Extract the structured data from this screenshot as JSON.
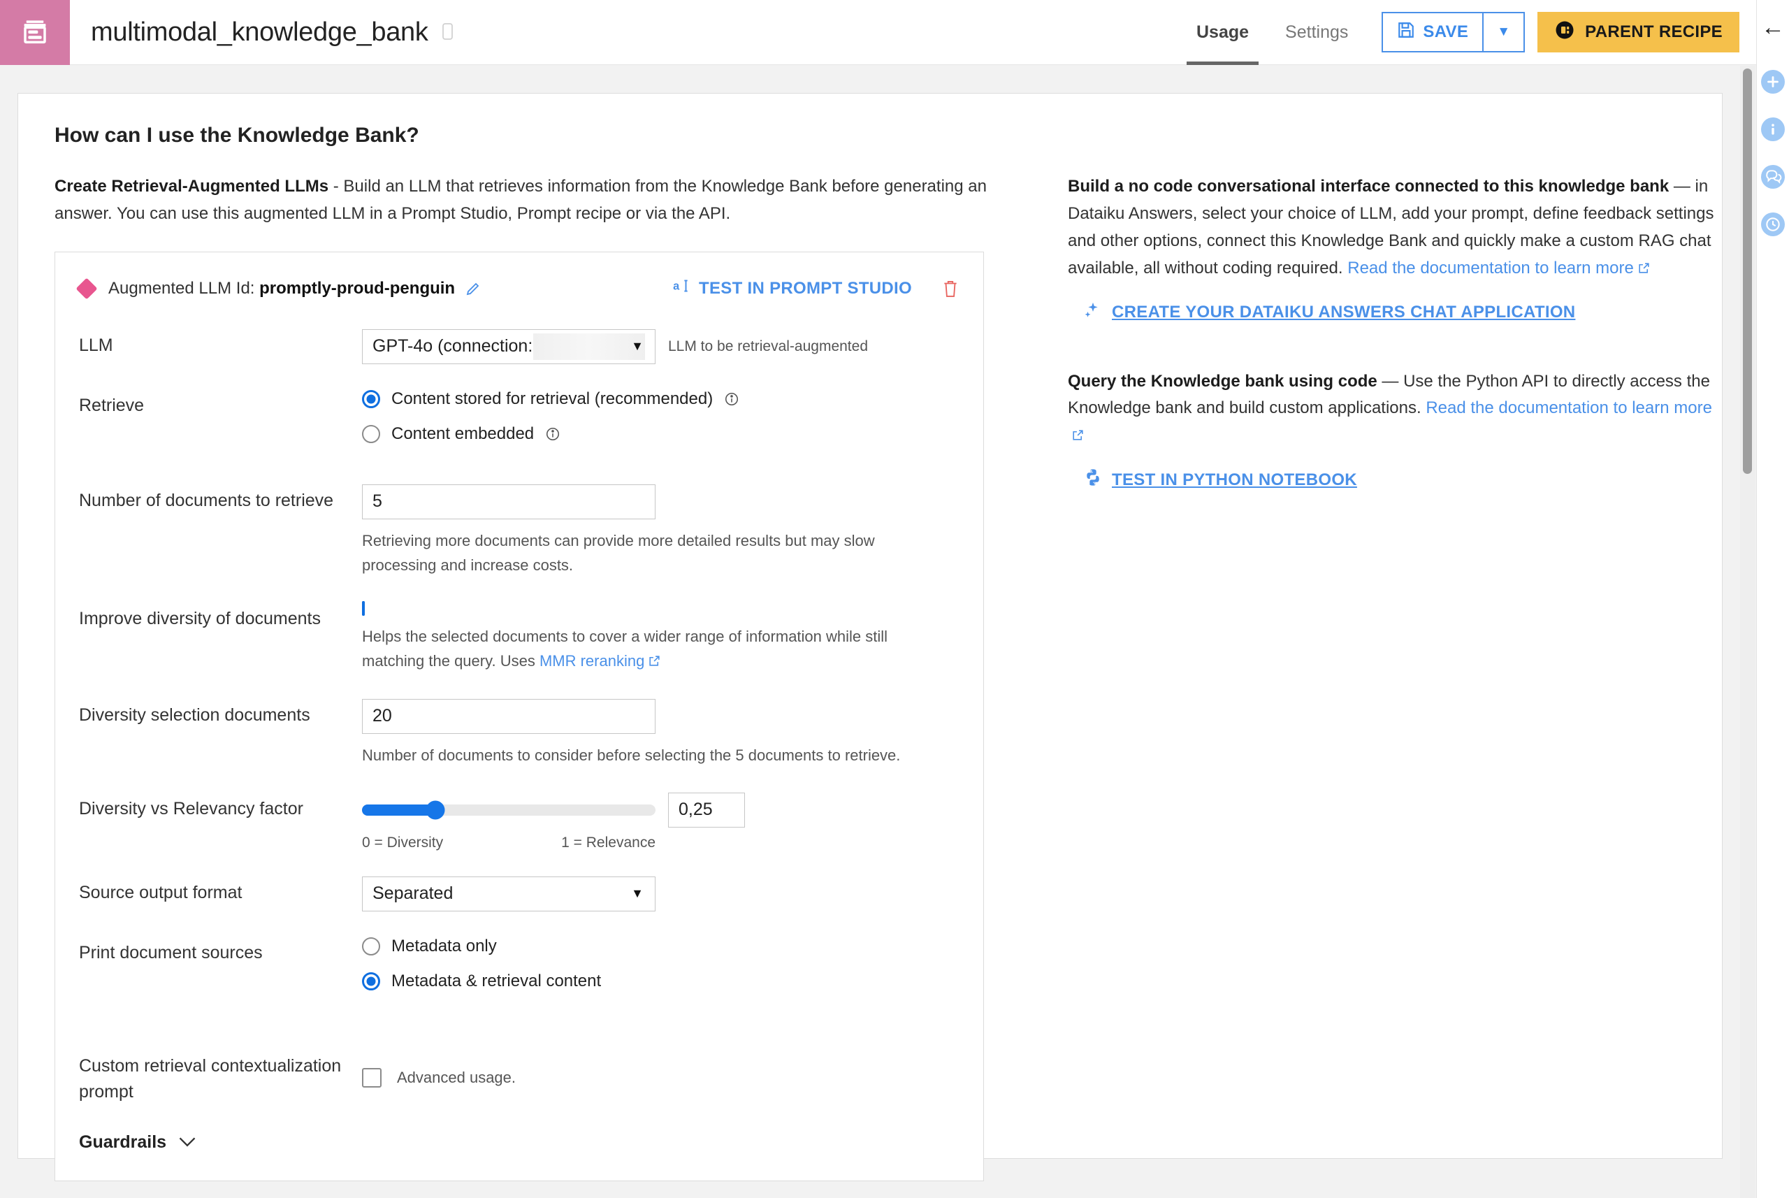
{
  "header": {
    "logo_icon": "knowledge-bank-icon",
    "logo_color": "#d47ba6",
    "title": "multimodal_knowledge_bank",
    "copy_icon": "copy-icon",
    "tabs": [
      {
        "label": "Usage",
        "active": true
      },
      {
        "label": "Settings",
        "active": false
      }
    ],
    "save_label": "SAVE",
    "save_icon": "floppy-disk-icon",
    "save_caret_icon": "chevron-down-icon",
    "parent_recipe_label": "PARENT RECIPE",
    "parent_recipe_icon": "recipe-icon",
    "parent_recipe_color": "#f5c04b",
    "accent_blue": "#4a90e8"
  },
  "rail": {
    "back_icon": "arrow-left-icon",
    "items": [
      {
        "icon": "plus-icon"
      },
      {
        "icon": "info-icon"
      },
      {
        "icon": "discussions-icon"
      },
      {
        "icon": "history-clock-icon"
      }
    ],
    "icon_color": "#9ec8f5"
  },
  "main": {
    "section_title": "How can I use the Knowledge Bank?",
    "left": {
      "intro_bold": "Create Retrieval-Augmented LLMs",
      "intro_rest": " - Build an LLM that retrieves information from the Knowledge Bank before generating an answer. You can use this augmented LLM in a Prompt Studio, Prompt recipe or via the API.",
      "card": {
        "id_prefix": "Augmented LLM Id:",
        "id_value": "promptly-proud-penguin",
        "edit_icon": "pencil-icon",
        "test_prompt_label": "TEST IN PROMPT STUDIO",
        "test_prompt_icon": "prompt-studio-icon",
        "delete_icon": "trash-icon",
        "fields": {
          "llm_label": "LLM",
          "llm_value": "GPT-4o (connection:",
          "llm_hint": "LLM to be retrieval-augmented",
          "retrieve_label": "Retrieve",
          "retrieve_options": [
            {
              "label": "Content stored for retrieval (recommended)",
              "selected": true,
              "info": true
            },
            {
              "label": "Content embedded",
              "selected": false,
              "info": true
            }
          ],
          "num_docs_label": "Number of documents to retrieve",
          "num_docs_value": "5",
          "num_docs_help": "Retrieving more documents can provide more detailed results but may slow processing and increase costs.",
          "diversity_label": "Improve diversity of documents",
          "diversity_checked": true,
          "diversity_help_pre": "Helps the selected documents to cover a wider range of information while still matching the query. Uses ",
          "diversity_help_link": "MMR reranking",
          "div_sel_label": "Diversity selection documents",
          "div_sel_value": "20",
          "div_sel_help": "Number of documents to consider before selecting the 5 documents to retrieve.",
          "factor_label": "Diversity vs Relevancy factor",
          "factor_value": "0,25",
          "factor_fraction": 0.25,
          "factor_min_label": "0 = Diversity",
          "factor_max_label": "1 = Relevance",
          "source_format_label": "Source output format",
          "source_format_value": "Separated",
          "print_sources_label": "Print document sources",
          "print_sources_options": [
            {
              "label": "Metadata only",
              "selected": false
            },
            {
              "label": "Metadata & retrieval content",
              "selected": true
            }
          ],
          "custom_prompt_label": "Custom retrieval contextualization prompt",
          "custom_prompt_checked": false,
          "custom_prompt_help": "Advanced usage.",
          "guardrails_label": "Guardrails",
          "guardrails_icon": "chevron-down-icon"
        }
      }
    },
    "right": {
      "block1_bold": "Build a no code conversational interface connected to this knowledge bank",
      "block1_rest": " — in Dataiku Answers, select your choice of LLM, add your prompt, define feedback settings and other options, connect this Knowledge Bank and quickly make a custom RAG chat available, all without coding required. ",
      "block1_link": "Read the documentation to learn more",
      "block1_action": "CREATE YOUR DATAIKU ANSWERS CHAT APPLICATION",
      "block1_action_icon": "sparkles-icon",
      "block2_bold": "Query the Knowledge bank using code",
      "block2_rest": " — Use the Python API to directly access the Knowledge bank and build custom applications. ",
      "block2_link": "Read the documentation to learn more",
      "block2_action": "TEST IN PYTHON NOTEBOOK",
      "block2_action_icon": "python-icon"
    }
  }
}
